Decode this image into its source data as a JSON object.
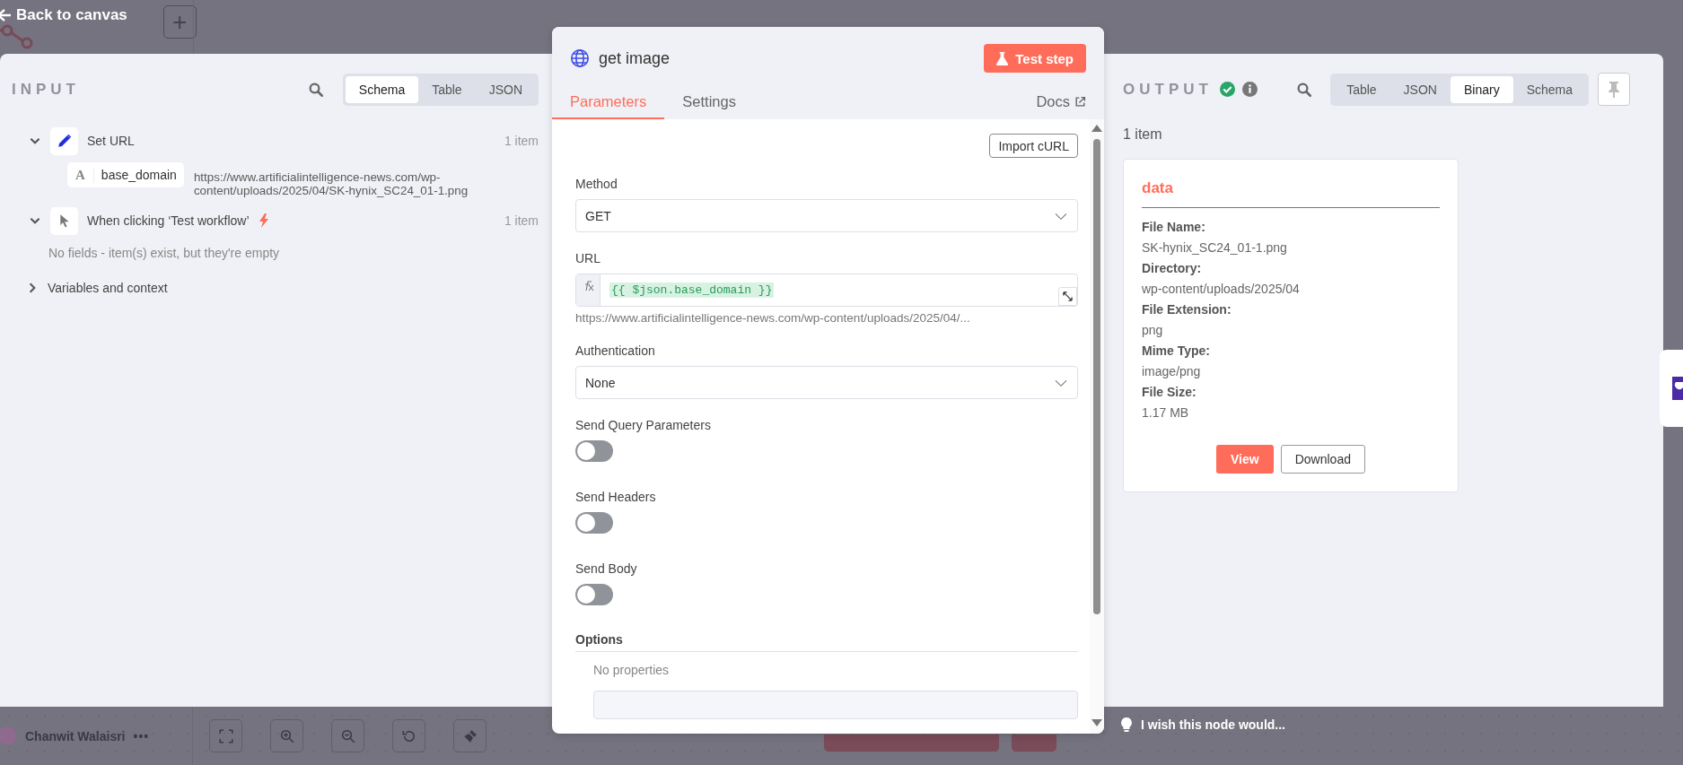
{
  "top_bar": {
    "back_label": "Back to canvas",
    "add_label": "+"
  },
  "input": {
    "title": "INPUT",
    "tabs": [
      {
        "label": "Schema",
        "selected": true
      },
      {
        "label": "Table",
        "selected": false
      },
      {
        "label": "JSON",
        "selected": false
      }
    ],
    "nodes": [
      {
        "name": "Set URL",
        "count": "1 item",
        "expanded": true,
        "trigger": false,
        "fields": [
          {
            "type": "A",
            "name": "base_domain",
            "value": "https://www.artificialintelligence-news.com/wp-content/uploads/2025/04/SK-hynix_SC24_01-1.png"
          }
        ]
      },
      {
        "name": "When clicking ‘Test workflow’",
        "count": "1 item",
        "expanded": true,
        "trigger": true,
        "empty_message": "No fields - item(s) exist, but they're empty"
      }
    ],
    "variables": {
      "label": "Variables and context",
      "expanded": false
    }
  },
  "node": {
    "title": "get image",
    "test_button": "Test step",
    "tabs": [
      {
        "label": "Parameters",
        "selected": true
      },
      {
        "label": "Settings",
        "selected": false
      }
    ],
    "docs_link": "Docs",
    "import_button": "Import cURL",
    "parameters": [
      {
        "kind": "select",
        "label": "Method",
        "value": "GET"
      },
      {
        "kind": "expression",
        "label": "URL",
        "value": "{{ $json.base_domain }}",
        "hint": "https://www.artificialintelligence-news.com/wp-content/uploads/2025/04/..."
      },
      {
        "kind": "select",
        "label": "Authentication",
        "value": "None"
      },
      {
        "kind": "toggle",
        "label": "Send Query Parameters",
        "on": false
      },
      {
        "kind": "toggle",
        "label": "Send Headers",
        "on": false
      },
      {
        "kind": "toggle",
        "label": "Send Body",
        "on": false
      },
      {
        "kind": "collection",
        "label": "Options",
        "empty_text": "No properties"
      }
    ]
  },
  "output": {
    "title": "OUTPUT",
    "success": true,
    "tabs": [
      {
        "label": "Table",
        "selected": false
      },
      {
        "label": "JSON",
        "selected": false
      },
      {
        "label": "Binary",
        "selected": true
      },
      {
        "label": "Schema",
        "selected": false
      }
    ],
    "count": "1 item",
    "binary": {
      "name": "data",
      "fields": [
        {
          "label": "File Name:",
          "value": "SK-hynix_SC24_01-1.png"
        },
        {
          "label": "Directory:",
          "value": "wp-content/uploads/2025/04"
        },
        {
          "label": "File Extension:",
          "value": "png"
        },
        {
          "label": "Mime Type:",
          "value": "image/png"
        },
        {
          "label": "File Size:",
          "value": "1.17 MB"
        }
      ],
      "view_button": "View",
      "download_button": "Download"
    }
  },
  "bottom_bar": {
    "user_name": "Chanwit Walaisri",
    "more_label": "•••",
    "feedback": "I wish this node would..."
  }
}
